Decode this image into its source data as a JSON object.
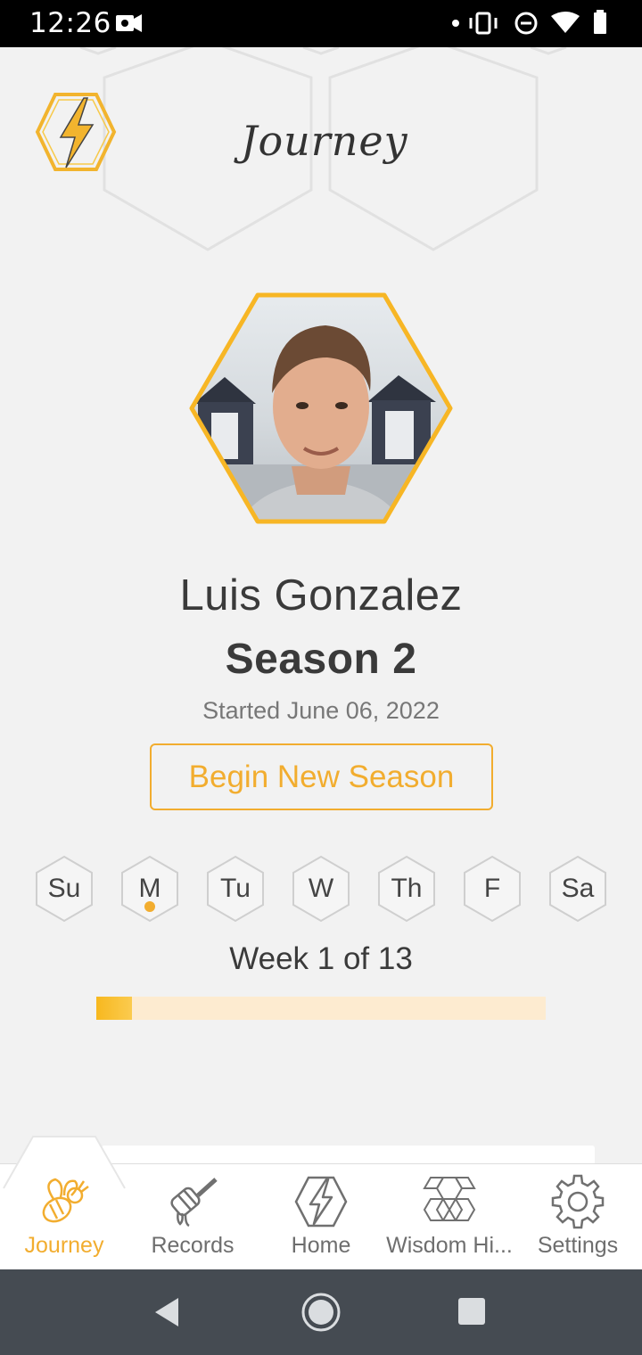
{
  "status_bar": {
    "time": "12:26"
  },
  "header": {
    "title": "Journey"
  },
  "profile": {
    "name": "Luis Gonzalez",
    "season": "Season 2",
    "started": "Started June 06, 2022",
    "begin_button": "Begin New Season"
  },
  "days": [
    {
      "label": "Su",
      "has_dot": false
    },
    {
      "label": "M",
      "has_dot": true
    },
    {
      "label": "Tu",
      "has_dot": false
    },
    {
      "label": "W",
      "has_dot": false
    },
    {
      "label": "Th",
      "has_dot": false
    },
    {
      "label": "F",
      "has_dot": false
    },
    {
      "label": "Sa",
      "has_dot": false
    }
  ],
  "week": {
    "label": "Week 1 of 13",
    "current": 1,
    "total": 13,
    "progress_fraction": 0.08
  },
  "nav": {
    "items": [
      {
        "label": "Journey",
        "icon": "bee-icon",
        "active": true
      },
      {
        "label": "Records",
        "icon": "honey-dipper-icon",
        "active": false
      },
      {
        "label": "Home",
        "icon": "lightning-hex-icon",
        "active": false
      },
      {
        "label": "Wisdom Hi...",
        "icon": "honeycomb-icon",
        "active": false
      },
      {
        "label": "Settings",
        "icon": "gear-icon",
        "active": false
      }
    ]
  },
  "colors": {
    "accent": "#f2ad2f",
    "track": "#fdebd0",
    "text": "#3a3a3a",
    "system_nav": "#454b52"
  }
}
